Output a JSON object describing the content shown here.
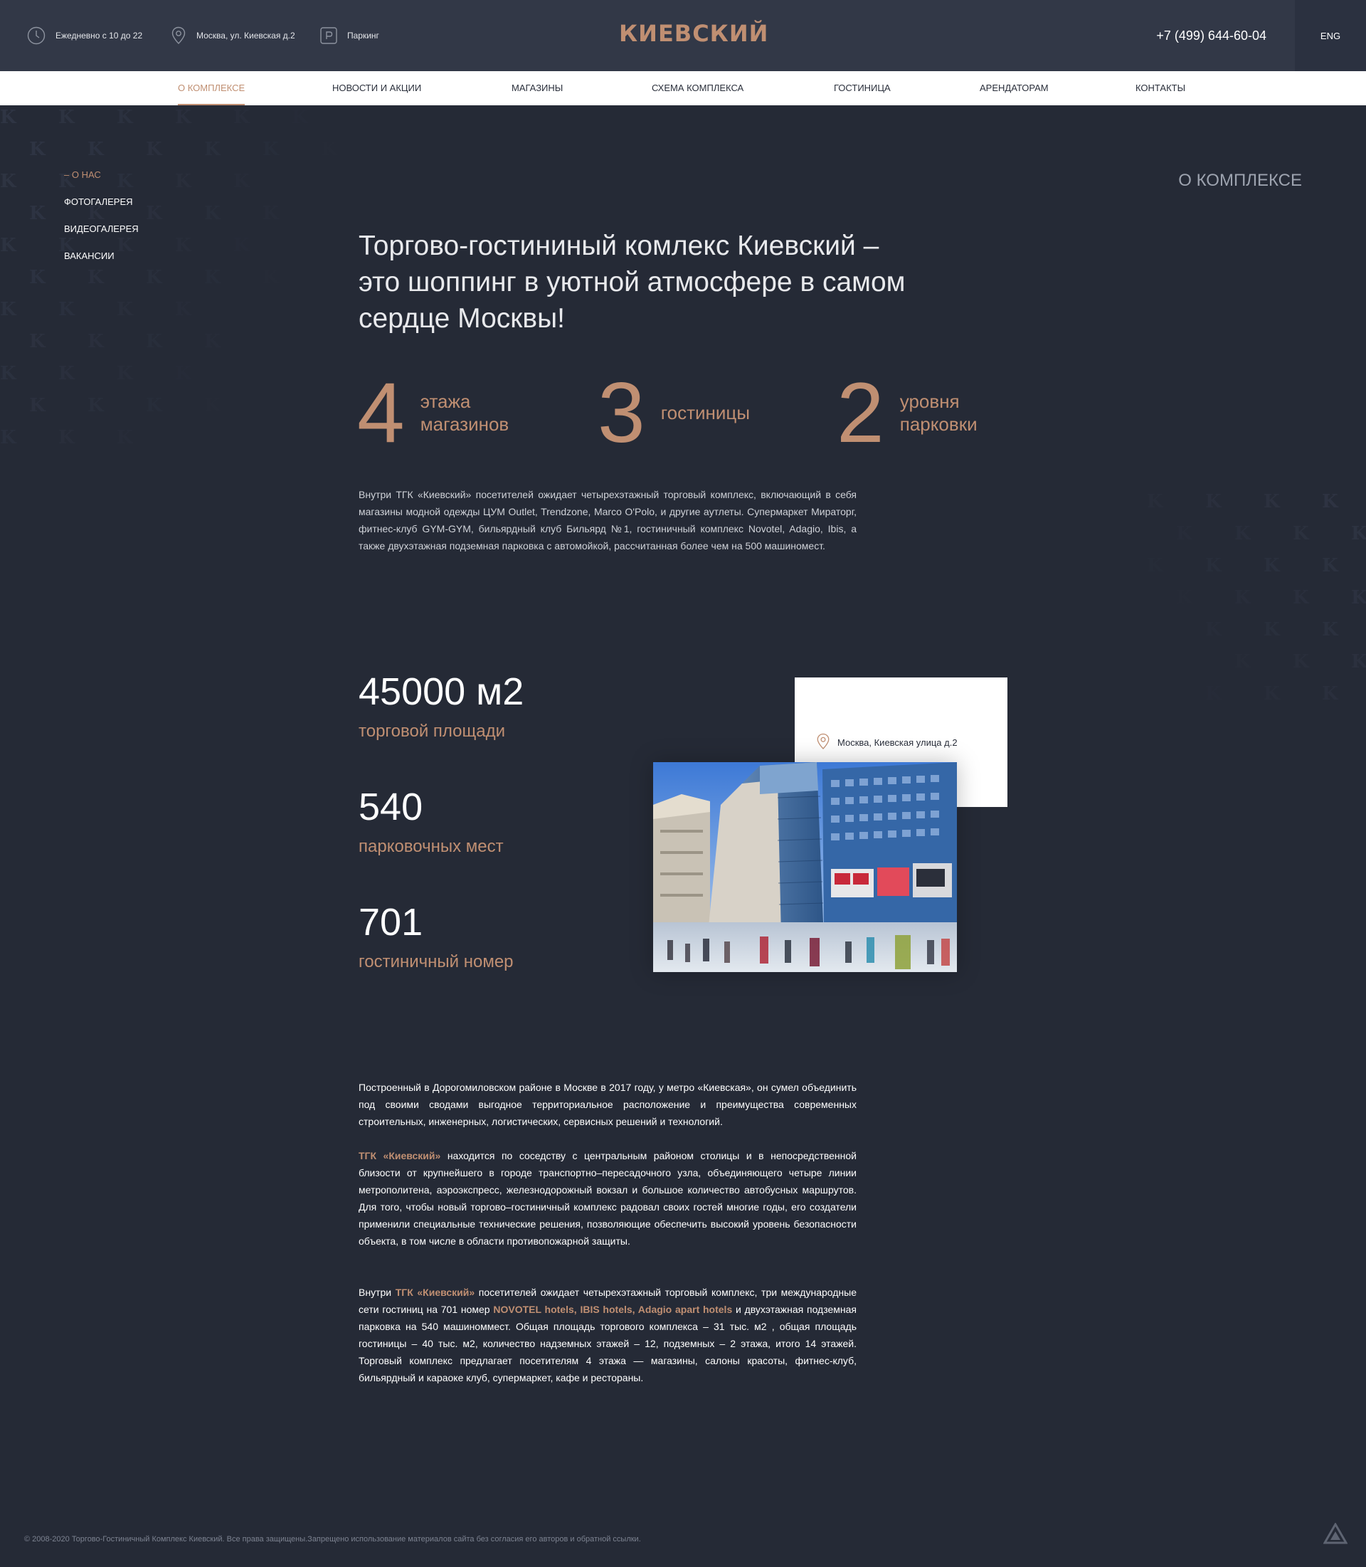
{
  "topbar": {
    "hours": "Ежедневно с 10 до 22",
    "address": "Москва, ул. Киевская д.2",
    "parking": "Паркинг",
    "logo": "КИЕВСКИЙ",
    "phone": "+7 (499) 644-60-04",
    "lang": "ENG",
    "icons": [
      "clock-icon",
      "location-pin-icon",
      "parking-icon"
    ]
  },
  "nav": {
    "items": [
      {
        "label": "О КОМПЛЕКСЕ",
        "active": true
      },
      {
        "label": "НОВОСТИ И АКЦИИ"
      },
      {
        "label": "МАГАЗИНЫ"
      },
      {
        "label": "СХЕМА КОМПЛЕКСА"
      },
      {
        "label": "ГОСТИНИЦА"
      },
      {
        "label": "АРЕНДАТОРАМ"
      },
      {
        "label": "КОНТАКТЫ"
      }
    ]
  },
  "side_menu": {
    "items": [
      {
        "label": "– О НАС",
        "active": true
      },
      {
        "label": "ФОТОГАЛЕРЕЯ"
      },
      {
        "label": "ВИДЕОГАЛЕРЕЯ"
      },
      {
        "label": "ВАКАНСИИ"
      }
    ]
  },
  "section_label": "О КОМПЛЕКСЕ",
  "headline": "Торгово-гостининый комлекс Киевский – это шоппинг в уютной атмосфере в самом сердце Москвы!",
  "stats": [
    {
      "num": "4",
      "line1": "этажа",
      "line2": "магазинов"
    },
    {
      "num": "3",
      "line1": "гостиницы",
      "line2": ""
    },
    {
      "num": "2",
      "line1": "уровня",
      "line2": "парковки"
    }
  ],
  "intro": "Внутри ТГК «Киевский» посетителей ожидает четырехэтажный торговый комплекс, включающий в себя магазины модной одежды ЦУМ Outlet, Trendzone, Marco O'Polo, и другие аутлеты. Супермаркет Мираторг, фитнес-клуб GYM-GYM, бильярдный клуб Бильярд №1, гостиничный комплекс Novotel, Adagio, Ibis, а также двухэтажная подземная парковка с автомойкой, рассчитанная более чем на 500 машиномест.",
  "big_stats": [
    {
      "value": "45000 м2",
      "caption": "торговой площади"
    },
    {
      "value": "540",
      "caption": "парковочных мест"
    },
    {
      "value": "701",
      "caption": "гостиничный номер"
    }
  ],
  "map_card": {
    "address": "Москва, Киевская улица д.2"
  },
  "body": {
    "p1": "Построенный в Дорогомиловском районе в Москве в 2017 году, у метро «Киевская», он сумел объединить под своими сводами выгодное территориальное расположение и преимущества современных строительных, инженерных, логистических, сервисных решений и технологий.",
    "p2_hl": "ТГК «Киевский»",
    "p2_rest": " находится по соседству с центральным районом столицы и в непосредственной близости от крупнейшего в городе транспортно–пересадочного узла, объединяющего четыре линии метрополитена, аэроэкспресс, железнодорожный вокзал и большое количество автобусных маршрутов. Для того, чтобы новый торгово–гостиничный комплекс радовал своих гостей многие годы, его создатели применили специальные технические решения, позволяющие обеспечить высокий уровень безопасности объекта, в том числе в области противопожарной защиты.",
    "p3_a": "Внутри ",
    "p3_hl1": "ТГК «Киевский»",
    "p3_b": " посетителей ожидает четырехэтажный торговый комплекс, три международные сети гостиниц на 701 номер ",
    "p3_hl2": "NOVOTEL hotels",
    "p3_c": ", ",
    "p3_hl3": "IBIS hotels",
    "p3_d": ", ",
    "p3_hl4": "Adagio apart hotels",
    "p3_e": " и двухэтажная подземная парковка на 540 машиноммест. Общая площадь торгового комплекса – 31 тыс. м2 , общая площадь гостиницы – 40 тыс. м2, количество надземных этажей – 12, подземных – 2 этажа, итого 14 этажей. Торговый комплекс предлагает посетителям 4 этажа — магазины, салоны красоты, фитнес-клуб, бильярдный и караоке клуб, супермаркет, кафе и рестораны."
  },
  "footer": "© 2008-2020 Торгово-Гостиничный Комплекс Киевский. Все права защищены.Запрещено использование материалов сайта без согласия его авторов и обратной ссылки.",
  "colors": {
    "accent": "#c08f72",
    "background": "#252a36",
    "topbar": "#323847"
  }
}
